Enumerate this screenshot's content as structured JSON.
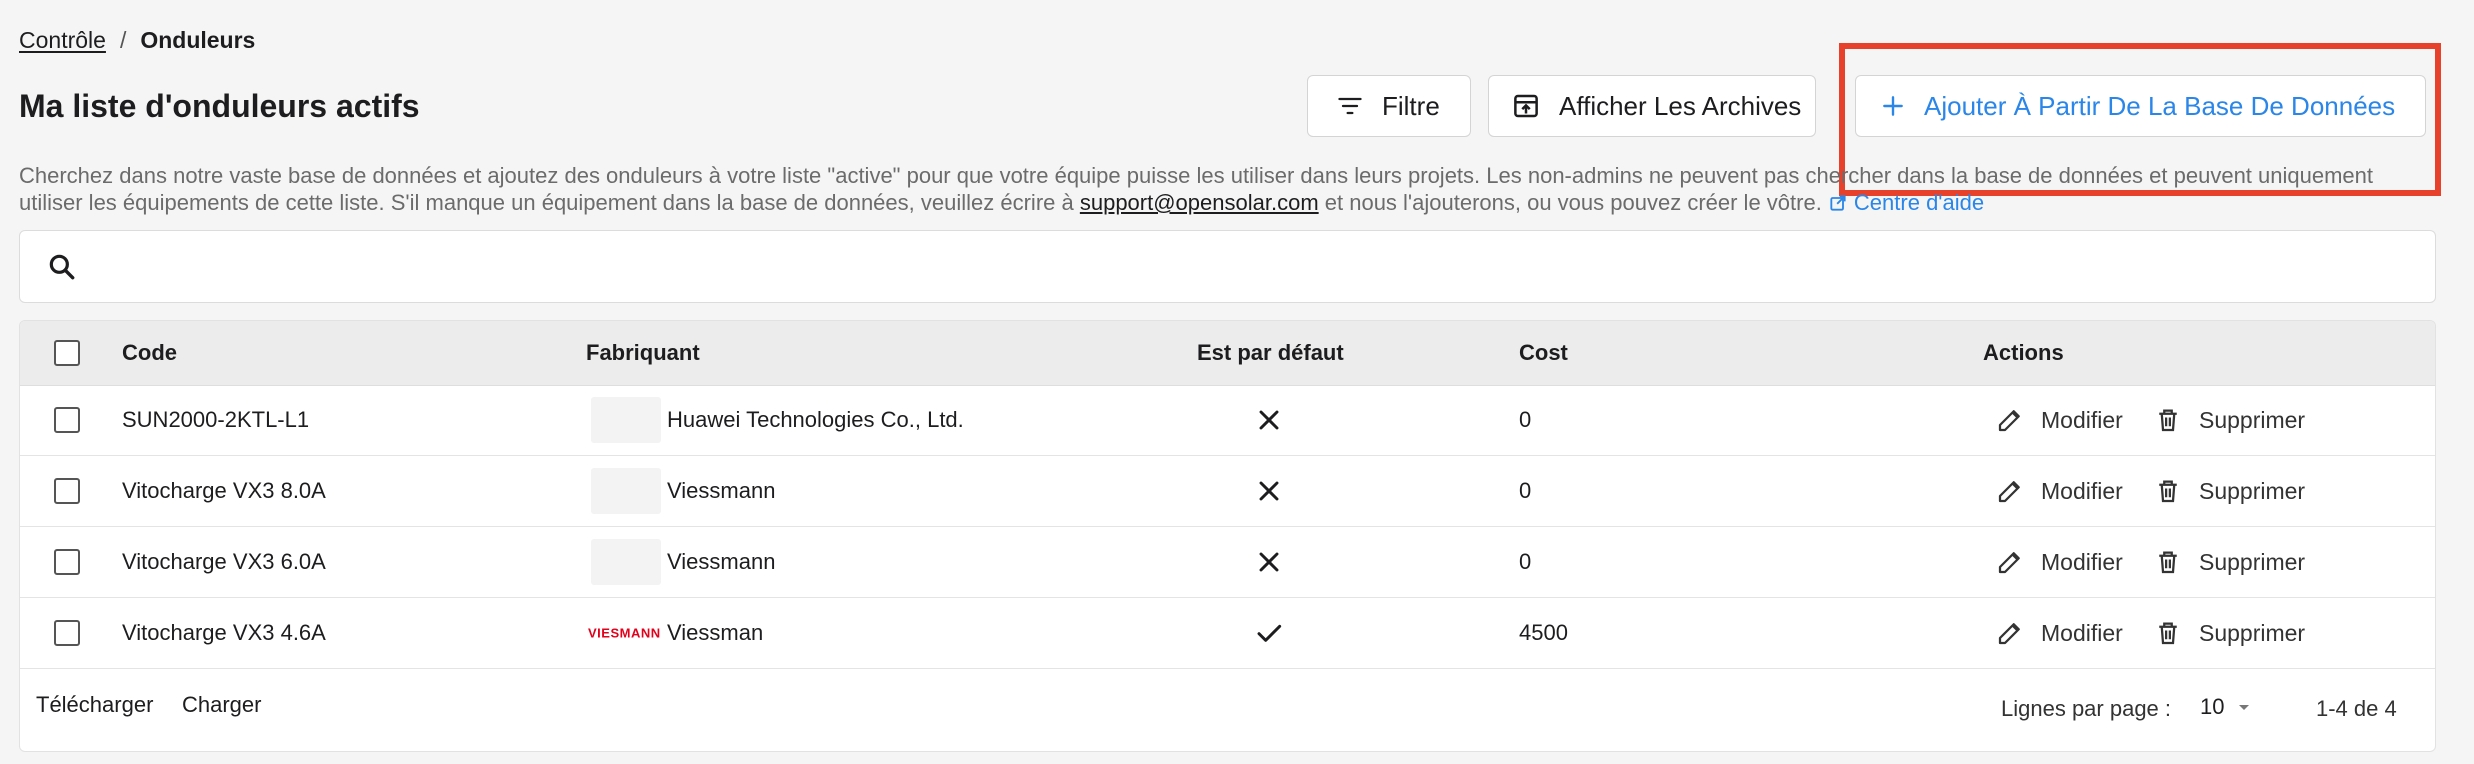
{
  "breadcrumb": {
    "parent": "Contrôle",
    "separator": "/",
    "current": "Onduleurs"
  },
  "page": {
    "title": "Ma liste d'onduleurs actifs"
  },
  "toolbar": {
    "filter_label": "Filtre",
    "archive_label": "Afficher Les Archives",
    "add_label": "Ajouter À Partir De La Base De Données"
  },
  "description": {
    "text_before": "Cherchez dans notre vaste base de données et ajoutez des onduleurs à votre liste \"active\" pour que votre équipe puisse les utiliser dans leurs projets. Les non-admins ne peuvent pas chercher dans la base de données et peuvent uniquement utiliser les équipements de cette liste. S'il manque un équipement dans la base de données, veuillez écrire à ",
    "email": "support@opensolar.com",
    "text_after": " et nous l'ajouterons, ou vous pouvez créer le vôtre. ",
    "help_link": "Centre d'aide"
  },
  "search": {
    "value": "",
    "placeholder": ""
  },
  "table": {
    "headers": {
      "code": "Code",
      "manufacturer": "Fabriquant",
      "default": "Est par défaut",
      "cost": "Cost",
      "actions": "Actions"
    },
    "rows": [
      {
        "code": "SUN2000-2KTL-L1",
        "manufacturer": "Huawei Technologies Co., Ltd.",
        "is_default": false,
        "cost": "0",
        "logo": "placeholder"
      },
      {
        "code": "Vitocharge VX3 8.0A",
        "manufacturer": "Viessmann",
        "is_default": false,
        "cost": "0",
        "logo": "placeholder"
      },
      {
        "code": "Vitocharge VX3 6.0A",
        "manufacturer": "Viessmann",
        "is_default": false,
        "cost": "0",
        "logo": "placeholder"
      },
      {
        "code": "Vitocharge VX3 4.6A",
        "manufacturer": "Viessman",
        "is_default": true,
        "cost": "4500",
        "logo": "VIESMANN"
      }
    ],
    "action_edit": "Modifier",
    "action_delete": "Supprimer"
  },
  "footer": {
    "download_label": "Télécharger",
    "upload_label": "Charger",
    "rows_per_page_label": "Lignes par page :",
    "rows_per_page_value": "10",
    "pagination_info": "1-4 de 4"
  },
  "colors": {
    "accent": "#2a86e8",
    "highlight": "#e8412b",
    "brand_logo": "#e3001b"
  },
  "icons": {
    "filter": "filter-icon",
    "archive": "archive-icon",
    "add": "plus-icon",
    "search": "search-icon",
    "edit": "pencil-icon",
    "delete": "trash-icon",
    "default_false": "close-icon",
    "default_true": "check-icon",
    "help": "external-link-icon",
    "dropdown": "caret-down-icon"
  }
}
